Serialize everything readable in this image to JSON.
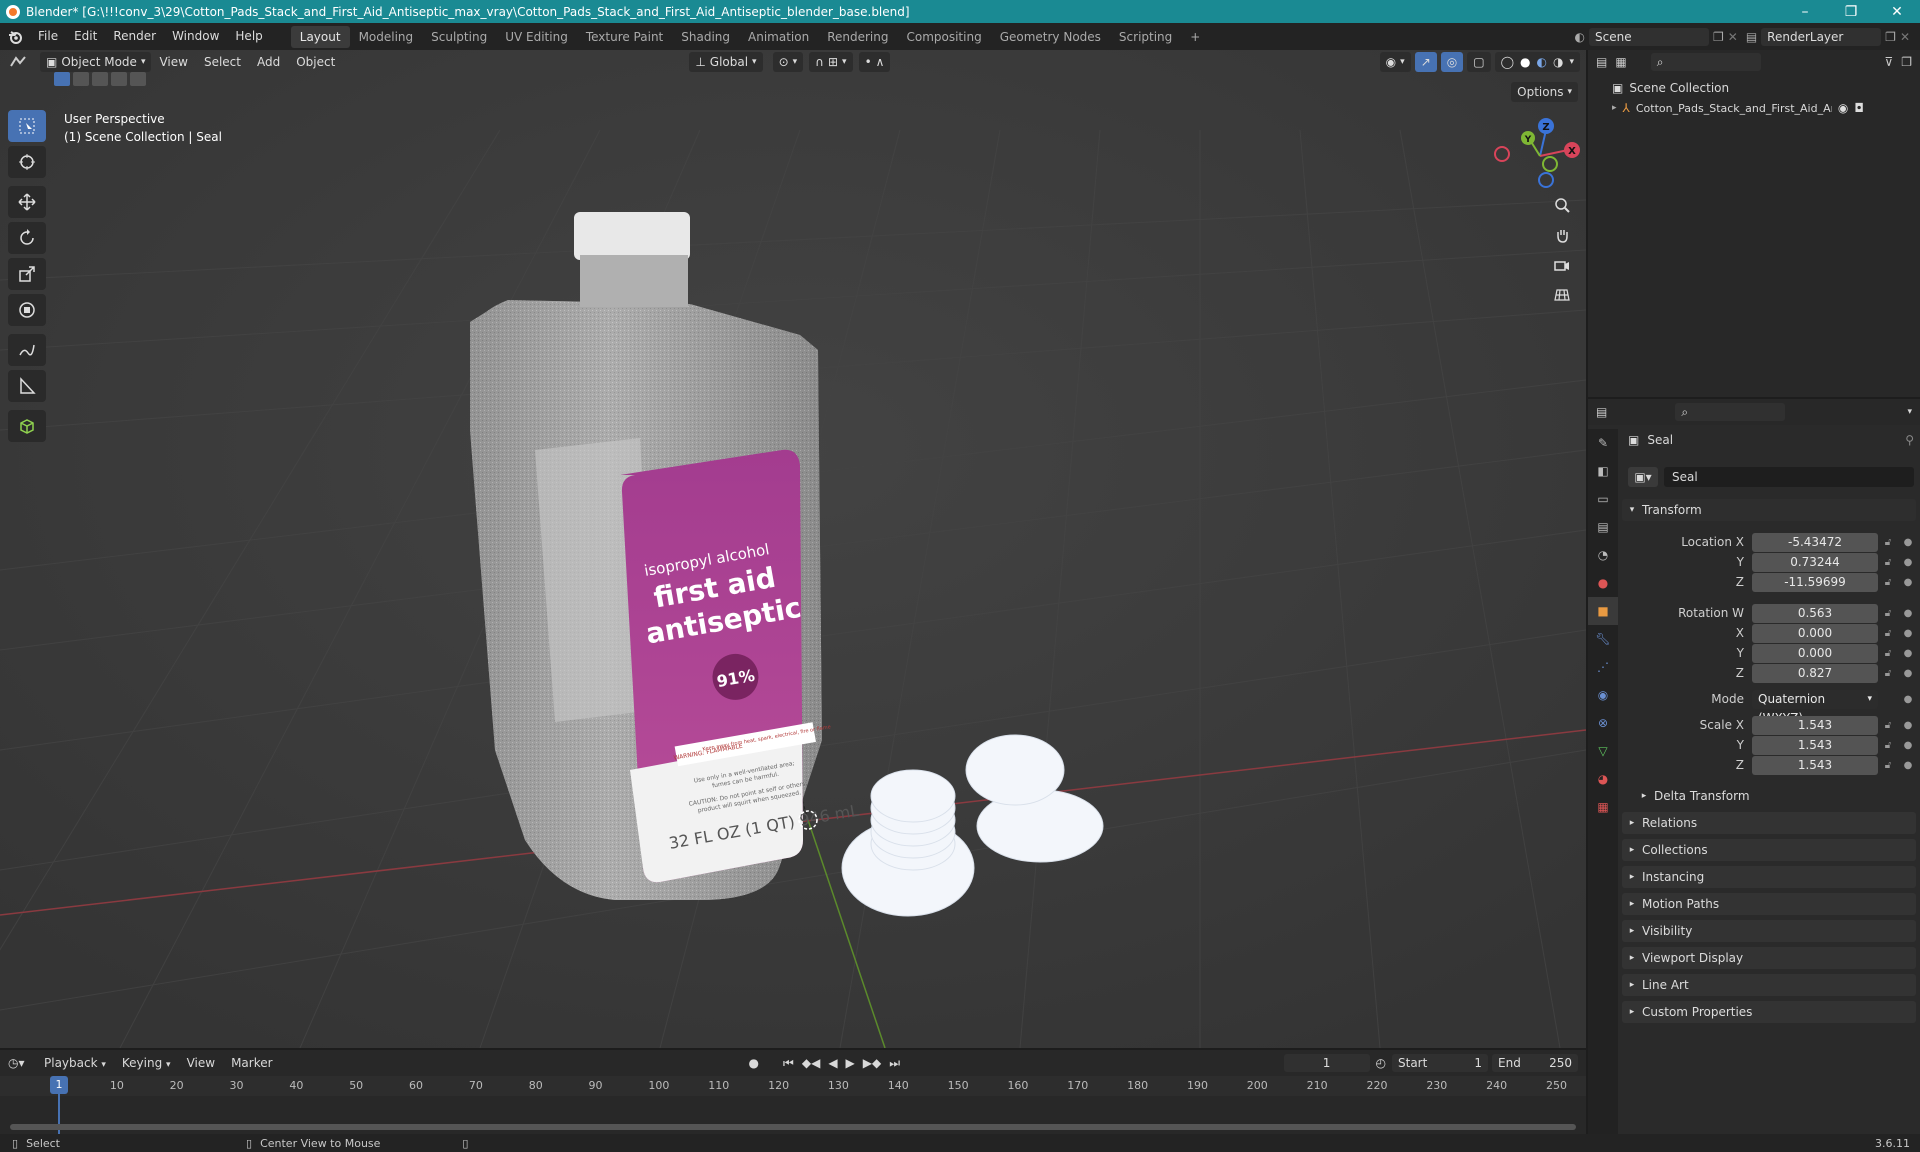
{
  "window": {
    "title": "Blender* [G:\\!!!conv_3\\29\\Cotton_Pads_Stack_and_First_Aid_Antiseptic_max_vray\\Cotton_Pads_Stack_and_First_Aid_Antiseptic_blender_base.blend]",
    "minimize": "–",
    "maximize": "❐",
    "close": "✕"
  },
  "menu": [
    "File",
    "Edit",
    "Render",
    "Window",
    "Help"
  ],
  "workspaces": [
    "Layout",
    "Modeling",
    "Sculpting",
    "UV Editing",
    "Texture Paint",
    "Shading",
    "Animation",
    "Rendering",
    "Compositing",
    "Geometry Nodes",
    "Scripting"
  ],
  "active_workspace": "Layout",
  "add_tab": "+",
  "scene": {
    "name": "Scene",
    "layer": "RenderLayer"
  },
  "viewport": {
    "mode": "Object Mode",
    "menus": [
      "View",
      "Select",
      "Add",
      "Object"
    ],
    "orientation": "Global",
    "options": "Options",
    "overlay_title": "User Perspective",
    "overlay_sub": "(1) Scene Collection | Seal",
    "gizmo": {
      "z": "Z",
      "y": "Y",
      "x": "X"
    }
  },
  "label": {
    "line1": "isopropyl alcohol",
    "line2": "first aid",
    "line3": "antiseptic",
    "pct": "91%",
    "warning": "WARNING: FLAMMABLE",
    "keep": "Keep away from heat, spark, electrical, fire or flame",
    "use1": "Use only in a well-ventilated area;",
    "use2": "fumes can be harmful.",
    "caution1": "CAUTION: Do not point at self or others;",
    "caution2": "product will squirt when squeezed.",
    "volume": "32 FL OZ (1 QT) 946 mL"
  },
  "outliner": {
    "root": "Scene Collection",
    "item": "Cotton_Pads_Stack_and_First_Aid_Antise"
  },
  "properties": {
    "object_name": "Seal",
    "data_name": "Seal",
    "transform": "Transform",
    "location": {
      "label": "Location X",
      "x": "-5.43472",
      "y": "0.73244",
      "z": "-11.59699"
    },
    "rotation": {
      "label": "Rotation W",
      "w": "0.563",
      "x": "0.000",
      "y": "0.000",
      "z": "0.827"
    },
    "mode_label": "Mode",
    "mode": "Quaternion (WXYZ)",
    "scale": {
      "label": "Scale X",
      "x": "1.543",
      "y": "1.543",
      "z": "1.543"
    },
    "axis": {
      "y": "Y",
      "z": "Z",
      "x": "X"
    },
    "delta": "Delta Transform",
    "panels": [
      "Relations",
      "Collections",
      "Instancing",
      "Motion Paths",
      "Visibility",
      "Viewport Display",
      "Line Art",
      "Custom Properties"
    ]
  },
  "timeline": {
    "menus": [
      "Playback",
      "Keying",
      "View",
      "Marker"
    ],
    "current": "1",
    "start_label": "Start",
    "start": "1",
    "end_label": "End",
    "end": "250",
    "ticks": [
      "1",
      "10",
      "20",
      "30",
      "40",
      "50",
      "60",
      "70",
      "80",
      "90",
      "100",
      "110",
      "120",
      "130",
      "140",
      "150",
      "160",
      "170",
      "180",
      "190",
      "200",
      "210",
      "220",
      "230",
      "240",
      "250"
    ]
  },
  "status": {
    "select": "Select",
    "center": "Center View to Mouse",
    "version": "3.6.11"
  }
}
